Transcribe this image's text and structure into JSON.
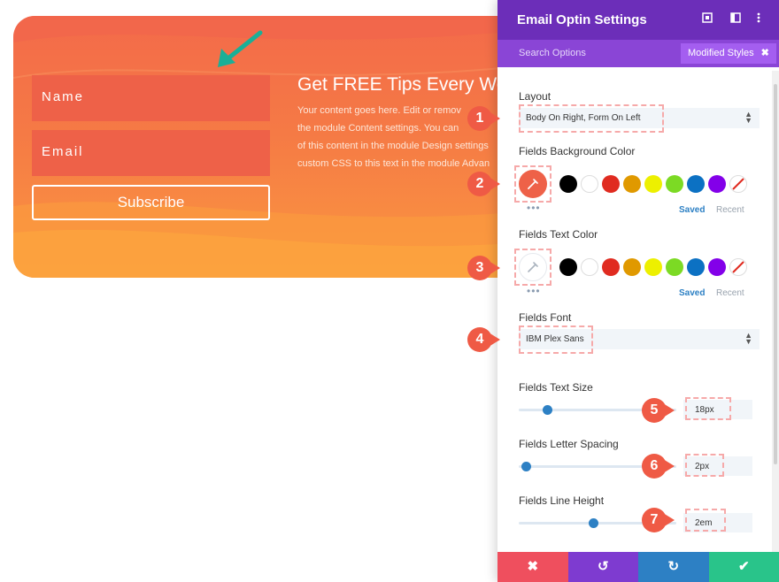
{
  "optin": {
    "name_placeholder": "Name",
    "email_placeholder": "Email",
    "subscribe_label": "Subscribe",
    "title": "Get FREE Tips Every Wee",
    "body": "Your content goes here. Edit or remov\nthe module Content settings. You can \nof this content in the module Design settings\ncustom CSS to this text in the module Advan"
  },
  "panel": {
    "title": "Email Optin Settings",
    "header_icons": [
      "fullscreen-icon",
      "split-view-icon",
      "more-options-icon"
    ],
    "search_label": "Search Options",
    "modified_styles_label": "Modified Styles",
    "modified_styles_close": "✖",
    "layout": {
      "label": "Layout",
      "value": "Body On Right, Form On Left"
    },
    "fields_bg_color": {
      "label": "Fields Background Color",
      "saved": "Saved",
      "recent": "Recent",
      "current": "#ee6148"
    },
    "fields_text_color": {
      "label": "Fields Text Color",
      "saved": "Saved",
      "recent": "Recent",
      "current": "#ffffff"
    },
    "fields_font": {
      "label": "Fields Font",
      "value": "IBM Plex Sans"
    },
    "fields_text_size": {
      "label": "Fields Text Size",
      "value": "18px"
    },
    "fields_letter_spacing": {
      "label": "Fields Letter Spacing",
      "value": "2px"
    },
    "fields_line_height": {
      "label": "Fields Line Height",
      "value": "2em"
    },
    "footer_icons": [
      "close-icon",
      "undo-icon",
      "redo-icon",
      "check-icon"
    ]
  },
  "swatches": [
    "#000000",
    "#ffffff",
    "#e02b20",
    "#e09900",
    "#edf000",
    "#7cda24",
    "#0c71c3",
    "#8300e9"
  ],
  "colors": {
    "panel_header": "#6c2eb9",
    "panel_tabs": "#8a45d6",
    "accent_blue": "#2d80c4",
    "callout_red": "#ef5a45",
    "arrow_teal": "#1aaf97",
    "footer": [
      "#ef4f5e",
      "#7e3bd0",
      "#2d80c4",
      "#29c48a"
    ]
  },
  "callouts": [
    "1",
    "2",
    "3",
    "4",
    "5",
    "6",
    "7"
  ]
}
